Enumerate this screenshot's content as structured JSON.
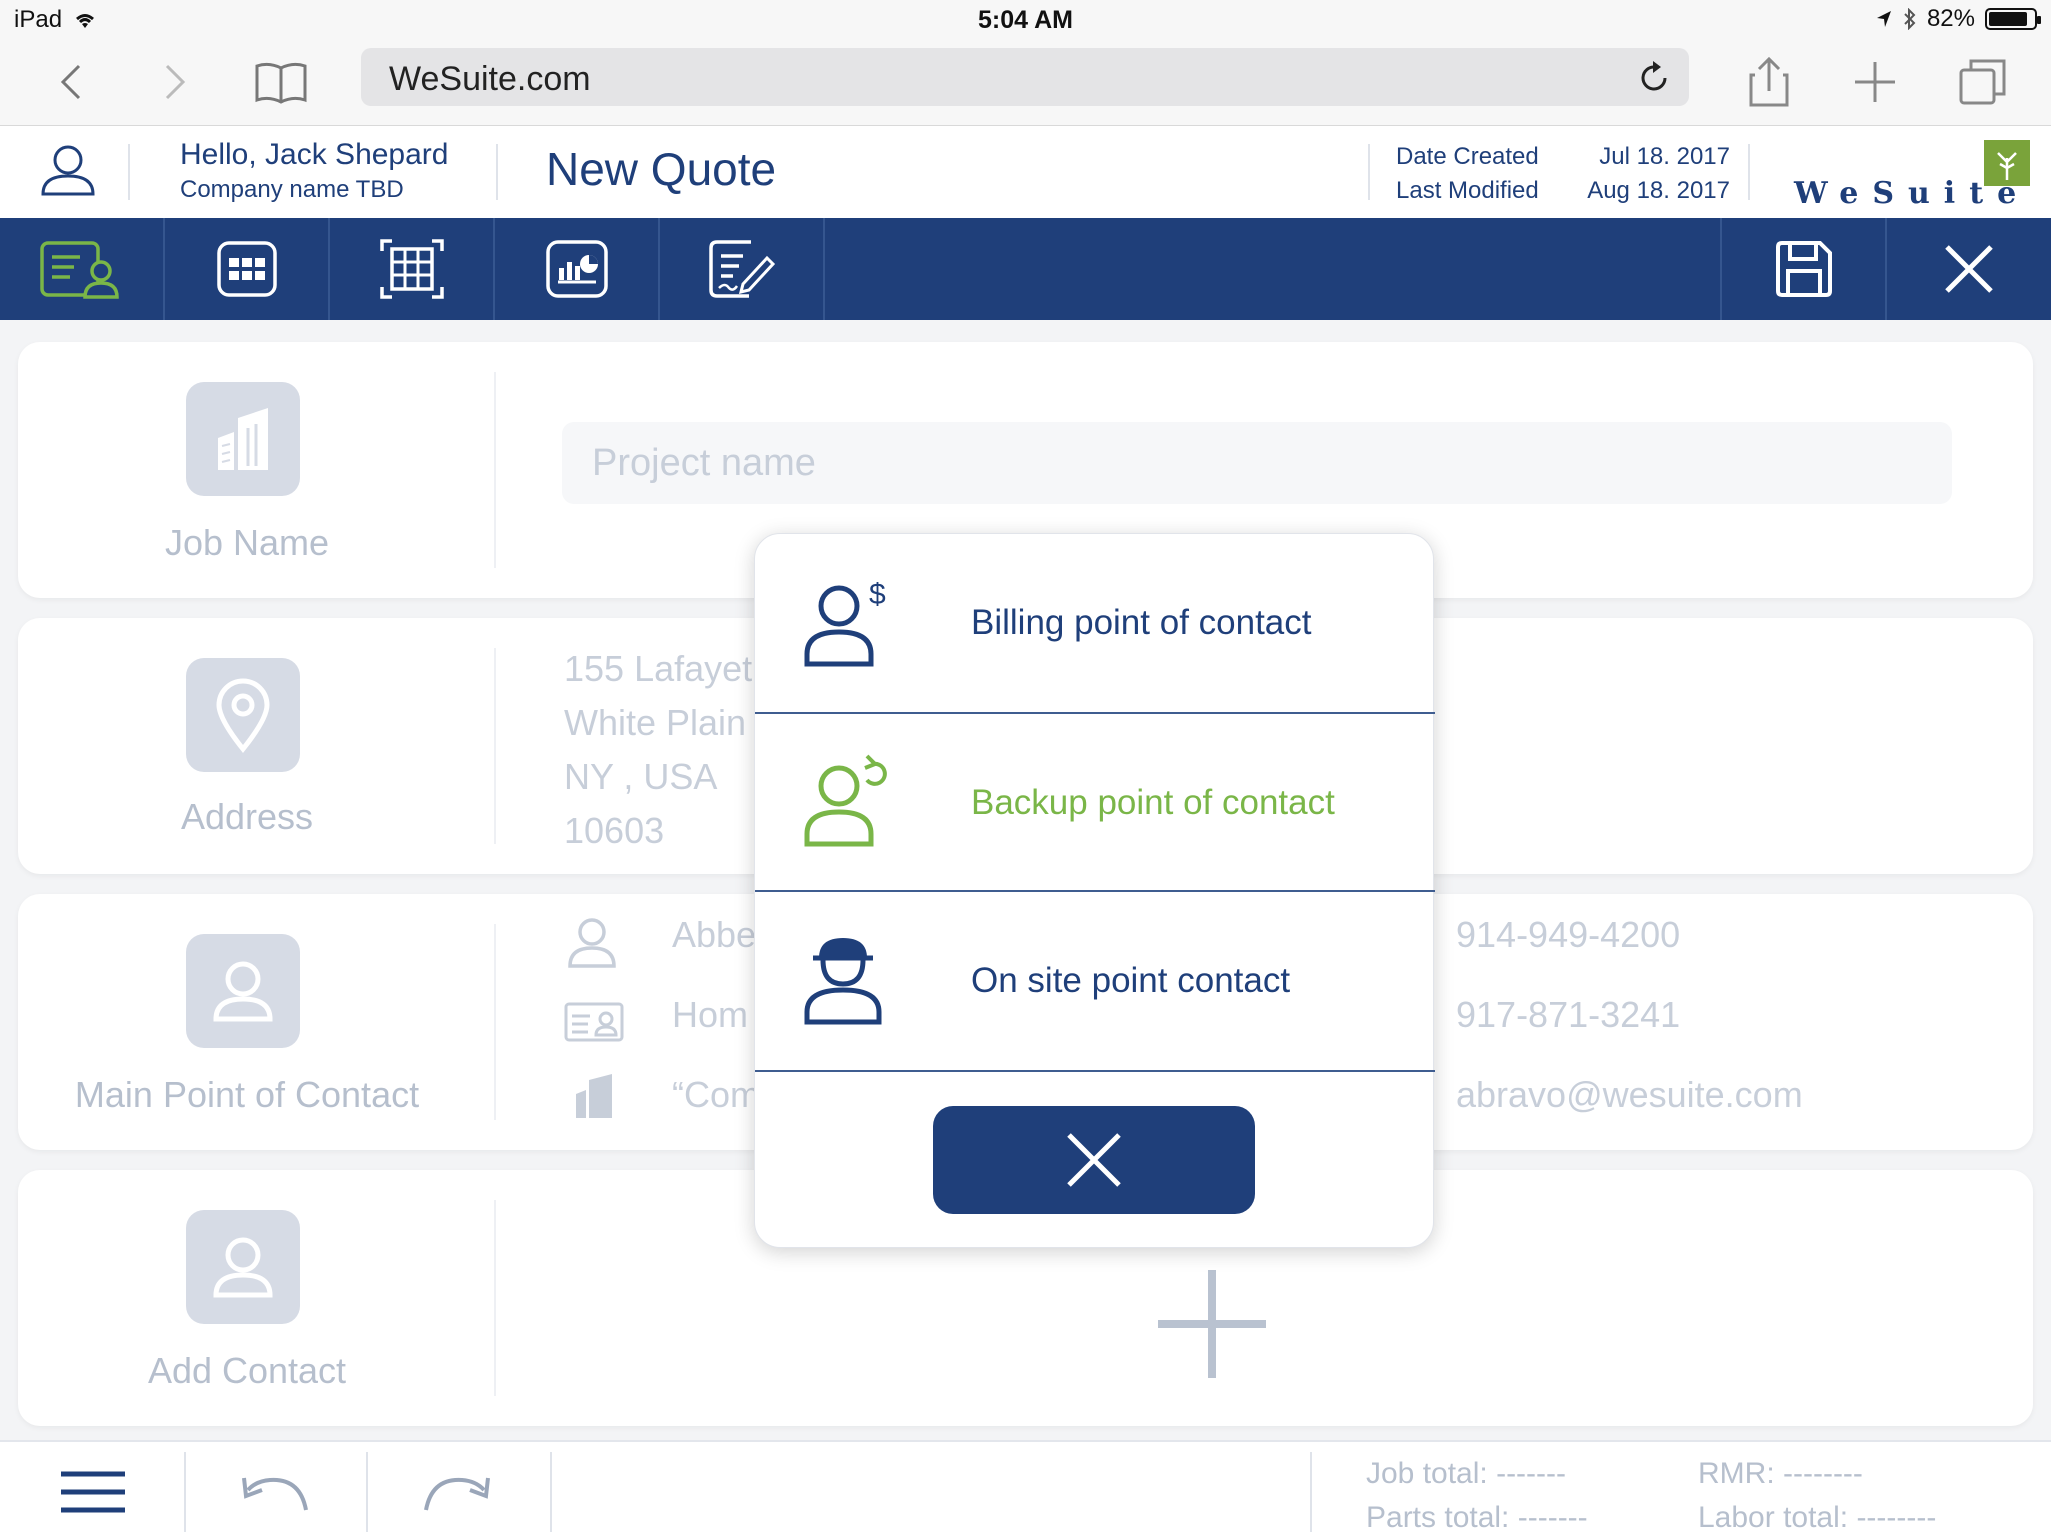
{
  "status_bar": {
    "device": "iPad",
    "time": "5:04 AM",
    "battery": "82%",
    "battery_level": 0.82
  },
  "browser": {
    "url": "WeSuite.com",
    "icons": [
      "chevron-left-icon",
      "chevron-right-icon",
      "bookmarks-icon",
      "reload-icon",
      "share-icon",
      "add-tab-icon",
      "tabs-icon"
    ]
  },
  "header": {
    "greeting": "Hello, Jack Shepard",
    "company": "Company name TBD",
    "title": "New Quote",
    "date_created_label": "Date Created",
    "last_modified_label": "Last Modified",
    "date_created": "Jul 18. 2017",
    "last_modified": "Aug 18. 2017",
    "logo_text": "WeSuite"
  },
  "colors": {
    "primary": "#1f3f7a",
    "accent_green": "#7ab648",
    "faded_text": "#c7ced9"
  },
  "nav": {
    "items": [
      "customer-info-icon",
      "grid-icon",
      "table-icon",
      "report-icon",
      "sign-document-icon"
    ],
    "save_icon": "save-icon",
    "close_icon": "close-icon"
  },
  "cards": {
    "job": {
      "label": "Job Name",
      "placeholder": "Project name"
    },
    "address": {
      "label": "Address",
      "line1": "155 Lafayet",
      "line2": "White Plain",
      "line3": "NY , USA",
      "line4": "10603"
    },
    "contact": {
      "label": "Main Point of Contact",
      "name": "Abbe",
      "type": "Hom",
      "company": "“Com",
      "phone1": "914-949-4200",
      "phone2": "917-871-3241",
      "email": "abravo@wesuite.com"
    },
    "add": {
      "label": "Add Contact"
    }
  },
  "bottom": {
    "job_total": "Job total: -------",
    "parts_total": "Parts total: -------",
    "rmr": "RMR: --------",
    "labor_total": "Labor total: --------"
  },
  "modal": {
    "options": [
      {
        "label": "Billing point of contact",
        "icon": "billing-contact-icon",
        "color": "#1f3f7a"
      },
      {
        "label": "Backup point of contact",
        "icon": "backup-contact-icon",
        "color": "#7ab648"
      },
      {
        "label": "On site point contact",
        "icon": "onsite-contact-icon",
        "color": "#1f3f7a"
      }
    ],
    "close_icon": "close-icon"
  }
}
